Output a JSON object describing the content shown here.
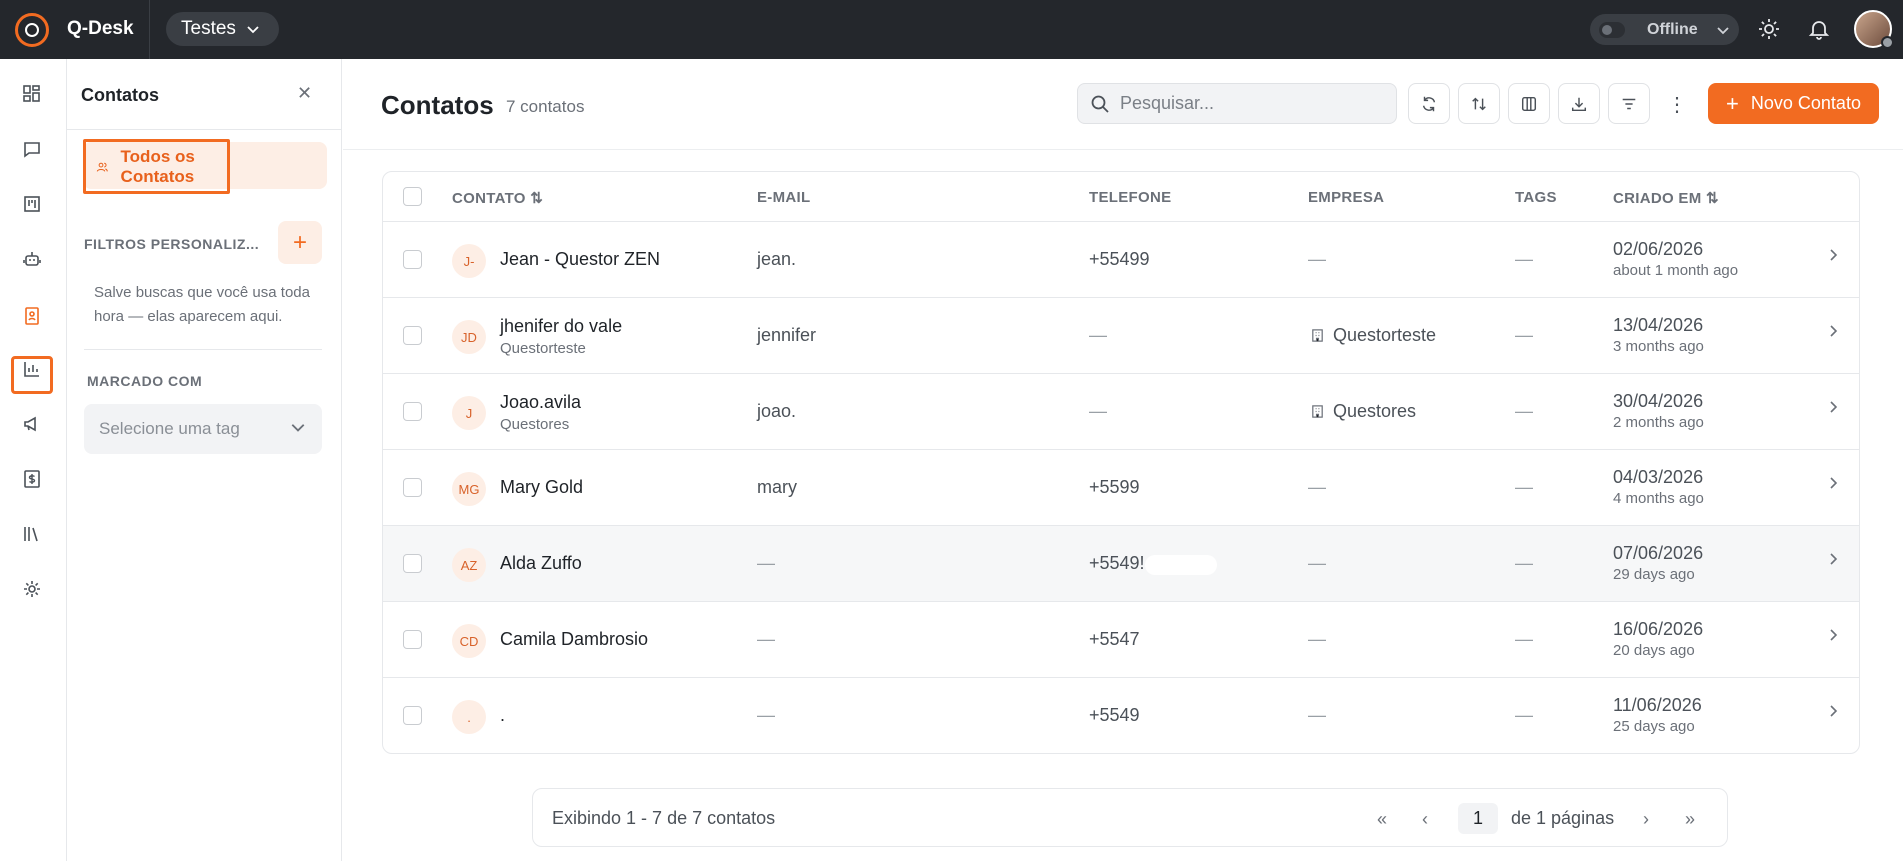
{
  "app": {
    "name": "Q-Desk",
    "workspace": "Testes",
    "status": "Offline"
  },
  "sidebar_rail": {
    "icons": [
      "dashboard-icon",
      "chat-icon",
      "kanban-icon",
      "bot-icon",
      "contacts-icon",
      "reports-icon",
      "campaigns-icon",
      "billing-icon",
      "library-icon",
      "settings-icon"
    ],
    "active": "contacts-icon"
  },
  "contacts_sidebar": {
    "title": "Contatos",
    "all_contacts": "Todos os Contatos",
    "filters_title": "FILTROS PERSONALIZ...",
    "filters_help": "Salve buscas que você usa toda hora — elas aparecem aqui.",
    "tag_section": "MARCADO COM",
    "tag_placeholder": "Selecione uma tag"
  },
  "main": {
    "title": "Contatos",
    "count": "7 contatos",
    "search_placeholder": "Pesquisar...",
    "new_button": "Novo Contato"
  },
  "table": {
    "columns": {
      "contact": "CONTATO",
      "email": "E-MAIL",
      "phone": "TELEFONE",
      "company": "EMPRESA",
      "tags": "TAGS",
      "created": "CRIADO EM"
    },
    "rows": [
      {
        "initials": "J-",
        "name": "Jean - Questor ZEN",
        "subtitle": "",
        "email": "jean.",
        "phone": "+55499",
        "company": "—",
        "tags": "—",
        "date": "02/06/2026",
        "ago": "about 1 month ago"
      },
      {
        "initials": "JD",
        "name": "jhenifer do vale",
        "subtitle": "Questorteste",
        "email": "jennifer",
        "phone": "—",
        "company": "Questorteste",
        "tags": "—",
        "date": "13/04/2026",
        "ago": "3 months ago"
      },
      {
        "initials": "J",
        "name": "Joao.avila",
        "subtitle": "Questores",
        "email": "joao.",
        "phone": "—",
        "company": "Questores",
        "tags": "—",
        "date": "30/04/2026",
        "ago": "2 months ago"
      },
      {
        "initials": "MG",
        "name": "Mary Gold",
        "subtitle": "",
        "email": "mary",
        "phone": "+5599",
        "company": "—",
        "tags": "—",
        "date": "04/03/2026",
        "ago": "4 months ago"
      },
      {
        "initials": "AZ",
        "name": "Alda Zuffo",
        "subtitle": "",
        "email": "—",
        "phone": "+5549!",
        "company": "—",
        "tags": "—",
        "date": "07/06/2026",
        "ago": "29 days ago"
      },
      {
        "initials": "CD",
        "name": "Camila Dambrosio",
        "subtitle": "",
        "email": "—",
        "phone": "+5547",
        "company": "—",
        "tags": "—",
        "date": "16/06/2026",
        "ago": "20 days ago"
      },
      {
        "initials": ".",
        "name": ".",
        "subtitle": "",
        "email": "—",
        "phone": "+5549",
        "company": "—",
        "tags": "—",
        "date": "11/06/2026",
        "ago": "25 days ago"
      }
    ]
  },
  "pagination": {
    "summary": "Exibindo 1 - 7 de 7 contatos",
    "page": "1",
    "of_pages": "de 1 páginas"
  },
  "colors": {
    "accent": "#f26b21",
    "topbar": "#24272c"
  }
}
